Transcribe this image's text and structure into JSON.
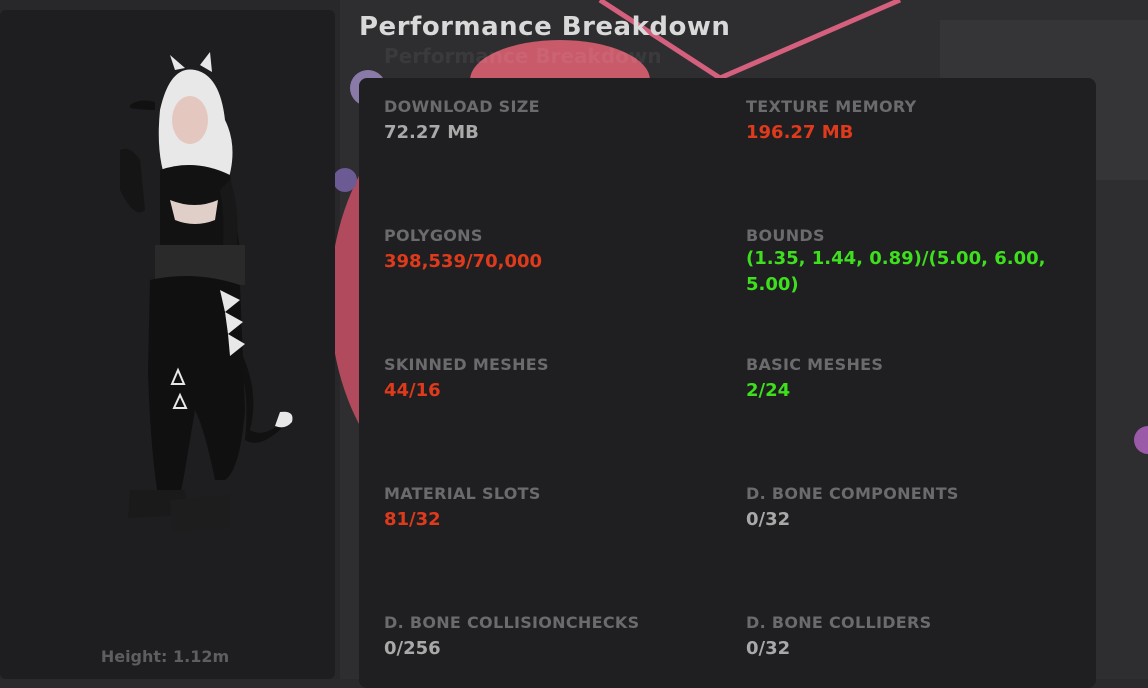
{
  "title": "Performance Breakdown",
  "ghost_title": "Performance Breakdown",
  "avatar": {
    "height_label": "Height: 1.12m"
  },
  "stats": [
    {
      "label": "DOWNLOAD SIZE",
      "value": "72.27 MB",
      "status_color": "#a9a9a9"
    },
    {
      "label": "TEXTURE MEMORY",
      "value": "196.27 MB",
      "status_color": "#e03a1c"
    },
    {
      "label": "POLYGONS",
      "value": "398,539/70,000",
      "status_color": "#e03a1c"
    },
    {
      "label": "BOUNDS",
      "value": "(1.35, 1.44, 0.89)/(5.00, 6.00, 5.00)",
      "status_color": "#3ee01e"
    },
    {
      "label": "SKINNED MESHES",
      "value": "44/16",
      "status_color": "#e03a1c"
    },
    {
      "label": "BASIC MESHES",
      "value": "2/24",
      "status_color": "#3ee01e"
    },
    {
      "label": "MATERIAL SLOTS",
      "value": "81/32",
      "status_color": "#e03a1c"
    },
    {
      "label": "D. BONE COMPONENTS",
      "value": "0/32",
      "status_color": "#a9a9a9"
    },
    {
      "label": "D. BONE COLLISIONCHECKS",
      "value": "0/256",
      "status_color": "#a9a9a9"
    },
    {
      "label": "D. BONE COLLIDERS",
      "value": "0/32",
      "status_color": "#a9a9a9"
    }
  ],
  "colors": {
    "bad": "#e03a1c",
    "good": "#3ee01e",
    "neutral": "#a9a9a9",
    "panel": "#1f1f21",
    "accent_pink": "#d4607e"
  }
}
